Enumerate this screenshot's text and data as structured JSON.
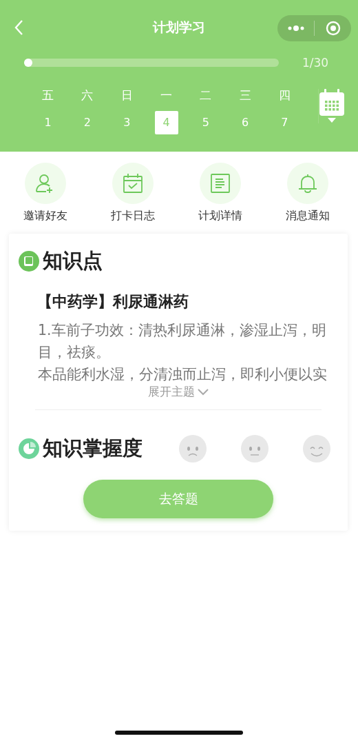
{
  "nav": {
    "title": "计划学习"
  },
  "progress": {
    "level": 0.0,
    "reading": "1/30"
  },
  "days": [
    {
      "weekday": "五",
      "date": "1",
      "selected": false
    },
    {
      "weekday": "六",
      "date": "2",
      "selected": false
    },
    {
      "weekday": "日",
      "date": "3",
      "selected": false
    },
    {
      "weekday": "一",
      "date": "4",
      "selected": true
    },
    {
      "weekday": "二",
      "date": "5",
      "selected": false
    },
    {
      "weekday": "三",
      "date": "6",
      "selected": false
    },
    {
      "weekday": "四",
      "date": "7",
      "selected": false
    }
  ],
  "shortcuts": [
    {
      "kind": "invite",
      "label": "邀请好友"
    },
    {
      "kind": "checkin",
      "label": "打卡日志"
    },
    {
      "kind": "details",
      "label": "计划详情"
    },
    {
      "kind": "notice",
      "label": "消息通知"
    }
  ],
  "knowledge": {
    "title": "知识点",
    "topic": "【中药学】利尿通淋药",
    "paragraphs": [
      "1.车前子功效：清热利尿通淋，渗湿止泻，明目，祛痰。",
      "本品能利水湿，分清浊而止泻，即利小便以实"
    ],
    "expand_label": "展开主题"
  },
  "mastery": {
    "title": "知识掌握度",
    "faces": [
      {
        "kind": "sad",
        "selected": false
      },
      {
        "kind": "neutral",
        "selected": false
      },
      {
        "kind": "happy",
        "selected": false
      }
    ]
  },
  "answer_button": "去答题"
}
